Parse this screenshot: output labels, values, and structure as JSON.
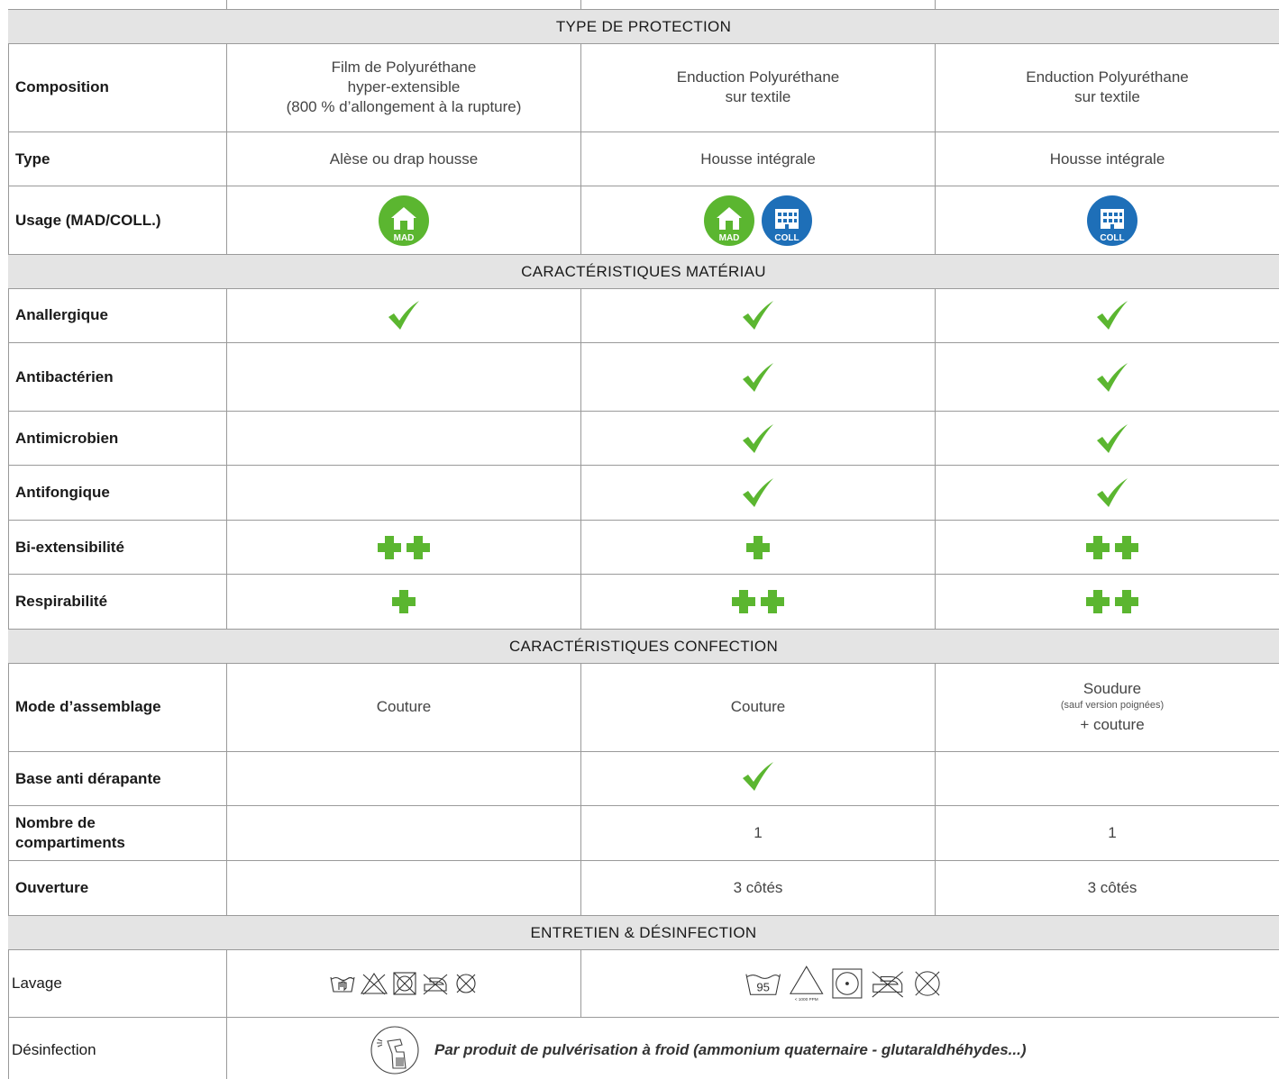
{
  "sections": {
    "protection": "TYPE DE  PROTECTION",
    "materiau": "CARACTÉRISTIQUES MATÉRIAU",
    "confection": "CARACTÉRISTIQUES CONFECTION",
    "entretien": "ENTRETIEN & DÉSINFECTION"
  },
  "rows": {
    "composition": {
      "label": "Composition",
      "c1": [
        "Film de Polyuréthane",
        "hyper-extensible",
        "(800 % d’allongement à la rupture)"
      ],
      "c2": [
        "Enduction Polyuréthane",
        "sur textile"
      ],
      "c3": [
        "Enduction Polyuréthane",
        "sur textile"
      ]
    },
    "type": {
      "label": "Type",
      "c1": "Alèse ou drap housse",
      "c2": "Housse intégrale",
      "c3": "Housse intégrale"
    },
    "usage": {
      "label": "Usage (MAD/COLL.)",
      "c1": [
        "MAD"
      ],
      "c2": [
        "MAD",
        "COLL"
      ],
      "c3": [
        "COLL"
      ]
    },
    "anallergique": {
      "label": "Anallergique",
      "c1": true,
      "c2": true,
      "c3": true
    },
    "antibacterien": {
      "label": "Antibactérien",
      "c1": false,
      "c2": true,
      "c3": true
    },
    "antimicrobien": {
      "label": "Antimicrobien",
      "c1": false,
      "c2": true,
      "c3": true
    },
    "antifongique": {
      "label": "Antifongique",
      "c1": false,
      "c2": true,
      "c3": true
    },
    "biext": {
      "label": "Bi-extensibilité",
      "c1": 2,
      "c2": 1,
      "c3": 2
    },
    "respir": {
      "label": "Respirabilité",
      "c1": 1,
      "c2": 2,
      "c3": 2
    },
    "assemblage": {
      "label": "Mode d’assemblage",
      "c1": "Couture",
      "c2": "Couture",
      "c3": {
        "main": "Soudure",
        "note": "(sauf version poignées)",
        "extra": "+ couture"
      }
    },
    "antiderapante": {
      "label": "Base anti dérapante",
      "c1": false,
      "c2": true,
      "c3": false
    },
    "compartiments": {
      "label_line1": "Nombre de",
      "label_line2": "compartiments",
      "c1": "",
      "c2": "1",
      "c3": "1"
    },
    "ouverture": {
      "label": "Ouverture",
      "c1": "",
      "c2": "3 côtés",
      "c3": "3 côtés"
    },
    "lavage": {
      "label": "Lavage",
      "left_icons": [
        "hand-wash-icon",
        "no-bleach-icon",
        "no-tumble-dry-icon",
        "no-iron-icon",
        "no-dry-clean-icon"
      ],
      "right_temp": "95",
      "right_note": "< 1000 PPM",
      "right_icons": [
        "wash-95-icon",
        "bleach-allowed-icon",
        "tumble-dry-icon",
        "no-iron-icon",
        "no-dry-clean-icon"
      ]
    },
    "desinfection": {
      "label": "Désinfection",
      "text": "Par produit de pulvérisation à froid (ammonium quaternaire - glutaraldhéhydes...)"
    }
  },
  "colors": {
    "green": "#5bb630",
    "blue": "#1e6fb8",
    "band": "#e4e4e4",
    "grid": "#9a9a9a"
  }
}
